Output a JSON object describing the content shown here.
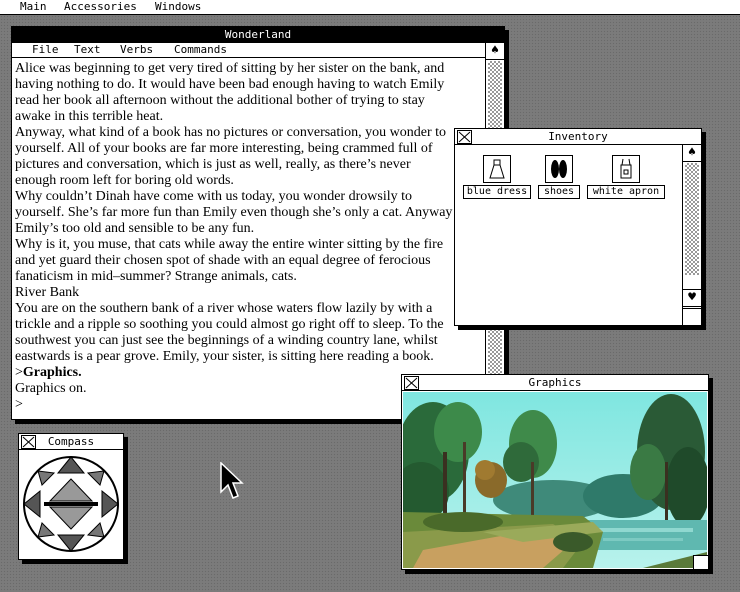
{
  "menubar": {
    "items": [
      "Main",
      "Accessories",
      "Windows"
    ]
  },
  "wonderland": {
    "title": "Wonderland",
    "menu": [
      "File",
      "Text",
      "Verbs",
      "Commands"
    ],
    "lines": [
      "Alice was beginning to get very tired of sitting by her sister on the bank, and",
      "having nothing to do. It would have been bad enough having to watch Emily",
      "read her book all afternoon without the additional bother of trying to stay",
      "awake in this terrible heat.",
      "Anyway, what kind of a book has no pictures or conversation, you wonder to",
      "yourself. All of your books are far more interesting, being crammed full of",
      "pictures and conversation, which is just as well, really, as there’s never",
      "enough room left for boring old words.",
      "Why couldn’t Dinah have come with us today, you wonder drowsily to",
      "yourself. She’s far more fun than Emily even though she’s only a cat. Anyway",
      "Emily’s too old and sensible to be any fun.",
      "Why is it, you muse, that cats while away the entire winter sitting by the fire",
      "and yet guard their chosen spot of shade with an equal degree of ferocious",
      "fanaticism in mid–summer? Strange animals, cats.",
      "River Bank",
      "You are on the southern bank of a river whose waters flow lazily by with a",
      "trickle and a ripple so soothing you could almost go right off to sleep. To the",
      "southwest you can just see the beginnings of a winding country lane, whilst",
      "eastwards is a pear grove. Emily, your sister, is sitting here reading a book."
    ],
    "command_prompt": ">",
    "command": "Graphics.",
    "response": "Graphics on.",
    "input_prompt": ">"
  },
  "inventory": {
    "title": "Inventory",
    "items": [
      {
        "label": "blue dress",
        "icon": "dress-icon"
      },
      {
        "label": "shoes",
        "icon": "shoes-icon"
      },
      {
        "label": "white apron",
        "icon": "apron-icon"
      }
    ]
  },
  "graphics": {
    "title": "Graphics",
    "picture": "river-bank-landscape"
  },
  "compass": {
    "title": "Compass"
  }
}
